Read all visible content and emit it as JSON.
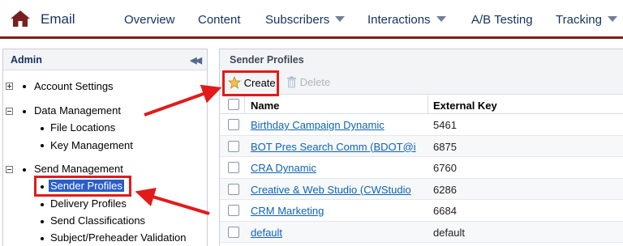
{
  "app": {
    "title": "Email"
  },
  "nav": {
    "items": [
      {
        "label": "Overview",
        "dropdown": false
      },
      {
        "label": "Content",
        "dropdown": false
      },
      {
        "label": "Subscribers",
        "dropdown": true
      },
      {
        "label": "Interactions",
        "dropdown": true
      },
      {
        "label": "A/B Testing",
        "dropdown": false
      },
      {
        "label": "Tracking",
        "dropdown": true
      }
    ]
  },
  "sidebar": {
    "title": "Admin",
    "tree": {
      "account_settings": "Account Settings",
      "data_management": "Data Management",
      "file_locations": "File Locations",
      "key_management": "Key Management",
      "send_management": "Send Management",
      "sender_profiles": "Sender Profiles",
      "delivery_profiles": "Delivery Profiles",
      "send_classifications": "Send Classifications",
      "subject_preheader": "Subject/Preheader Validation"
    },
    "selected": "Sender Profiles"
  },
  "main": {
    "title": "Sender Profiles",
    "toolbar": {
      "create": "Create",
      "delete": "Delete"
    },
    "columns": {
      "name": "Name",
      "key": "External Key"
    },
    "rows": [
      {
        "name": "Birthday Campaign Dynamic",
        "key": "5461"
      },
      {
        "name": "BOT Pres Search Comm (BDOT@i",
        "key": "6875"
      },
      {
        "name": "CRA Dynamic",
        "key": "6760"
      },
      {
        "name": "Creative & Web Studio (CWStudio",
        "key": "6286"
      },
      {
        "name": "CRM Marketing",
        "key": "6684"
      },
      {
        "name": "default",
        "key": "default"
      }
    ]
  },
  "colors": {
    "brand": "#7a1f1f",
    "annotation": "#e11b1b",
    "selection": "#2a5dc8",
    "link": "#0e64b4"
  }
}
